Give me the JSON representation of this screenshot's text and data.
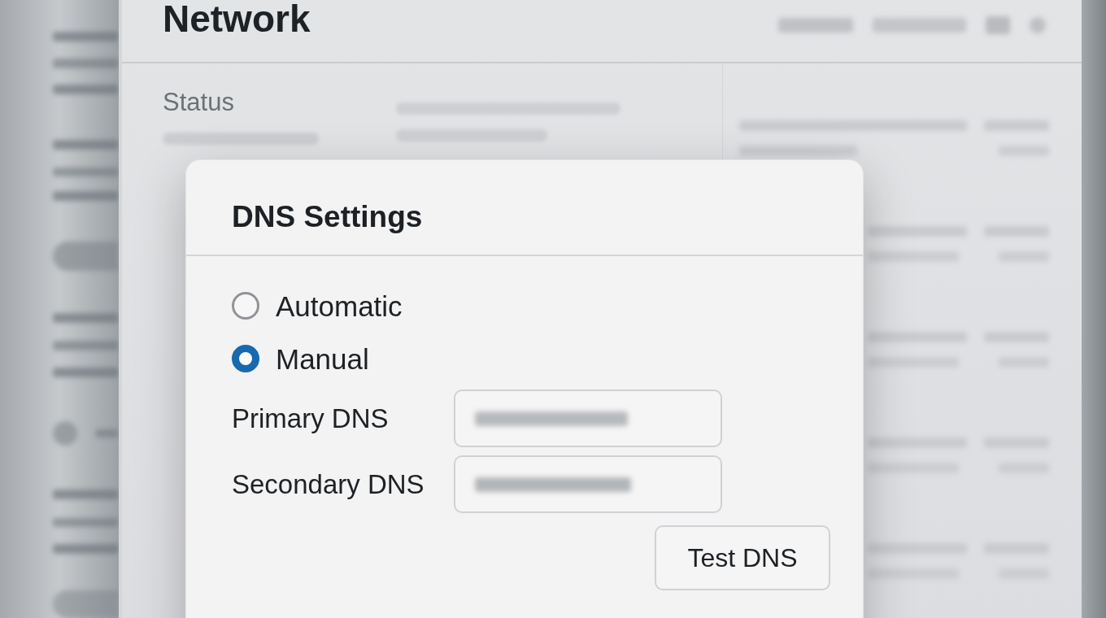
{
  "window": {
    "title": "Network"
  },
  "status": {
    "label": "Status"
  },
  "dialog": {
    "title": "DNS Settings",
    "dns_mode": [
      {
        "label": "Automatic",
        "selected": false
      },
      {
        "label": "Manual",
        "selected": true
      }
    ],
    "fields": [
      {
        "label": "Primary DNS"
      },
      {
        "label": "Secondary DNS"
      }
    ],
    "buttons": [
      "Test DNS"
    ]
  }
}
